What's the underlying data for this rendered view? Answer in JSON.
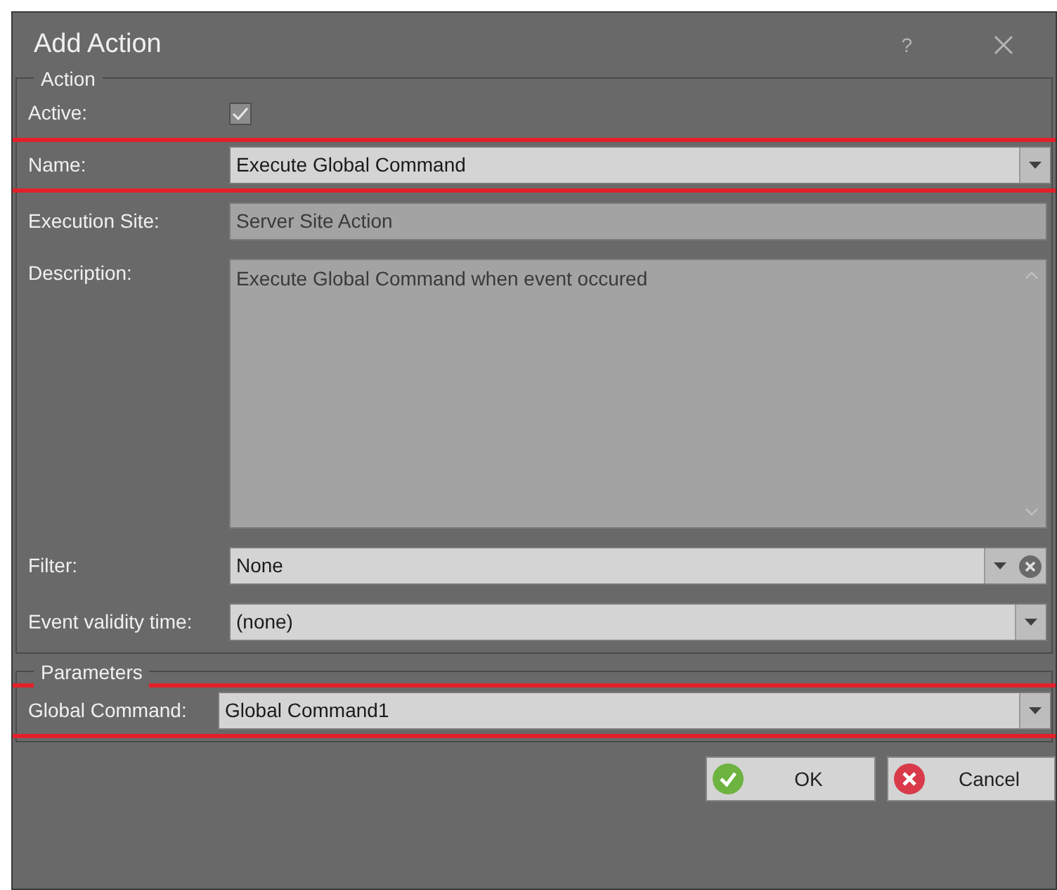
{
  "window": {
    "title": "Add Action",
    "help": "?"
  },
  "action_group": {
    "legend": "Action",
    "fields": [
      {
        "kind": "checkbox",
        "label": "Active:",
        "checked": true,
        "disabled": true,
        "highlighted": false
      },
      {
        "kind": "dropdown",
        "label": "Name:",
        "value": "Execute Global Command",
        "disabled": false,
        "highlighted": true
      },
      {
        "kind": "text",
        "label": "Execution Site:",
        "value": "Server Site Action",
        "disabled": true,
        "highlighted": false
      },
      {
        "kind": "textarea",
        "label": "Description:",
        "value": "Execute Global Command when event occured",
        "disabled": true,
        "highlighted": false
      },
      {
        "kind": "dropdown_clear",
        "label": "Filter:",
        "value": "None",
        "disabled": false,
        "highlighted": false
      },
      {
        "kind": "dropdown",
        "label": "Event validity time:",
        "value": "(none)",
        "disabled": false,
        "highlighted": false
      }
    ]
  },
  "parameters_group": {
    "legend": "Parameters",
    "fields": [
      {
        "kind": "dropdown",
        "label": "Global Command:",
        "value": "Global Command1",
        "disabled": false,
        "highlighted": true
      }
    ]
  },
  "buttons": [
    {
      "kind": "ok",
      "label": "OK"
    },
    {
      "kind": "cancel",
      "label": "Cancel"
    }
  ]
}
